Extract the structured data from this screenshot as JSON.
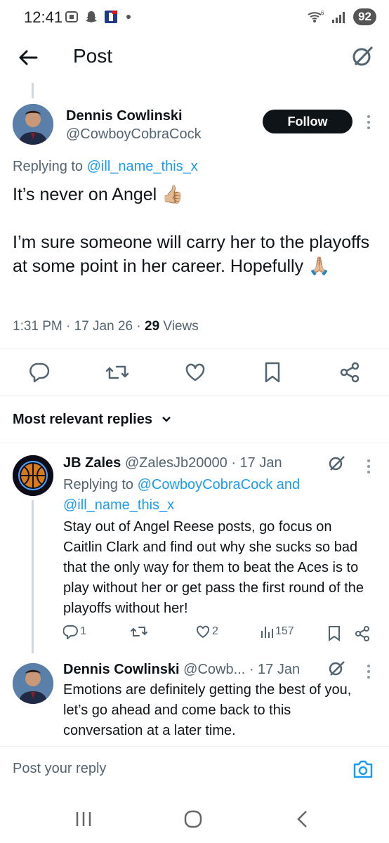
{
  "status_bar": {
    "time": "12:41",
    "battery": "92",
    "signal_label": "6"
  },
  "header": {
    "title": "Post"
  },
  "post": {
    "author_name": "Dennis Cowlinski",
    "author_handle": "@CowboyCobraCock",
    "follow_label": "Follow",
    "replying_prefix": "Replying to ",
    "replying_handle": "@ill_name_this_x",
    "text_line1": "It’s never on Angel 👍🏼",
    "text_line2": "I’m sure someone will carry her to the playoffs at some point in her career. Hopefully 🙏🏼",
    "time": "1:31 PM · 17 Jan 26 · ",
    "views_count": "29",
    "views_label": " Views"
  },
  "replies_section": {
    "title": "Most relevant replies",
    "chevron": "⌄"
  },
  "replies": [
    {
      "name": "JB Zales",
      "handle": "@ZalesJb20000 · 17 Jan",
      "replying_prefix": "Replying to ",
      "replying_handles": "@CowboyCobraCock and @ill_name_this_x",
      "text": "Stay out of Angel Reese posts, go focus on Caitlin Clark and find out why she sucks so bad that the only way for them to beat the Aces is to play without her or get pass the first round of the playoffs without her!",
      "reply_count": "1",
      "retweet_count": "",
      "like_count": "2",
      "view_count": "157"
    },
    {
      "name": "Dennis Cowlinski",
      "handle": "@Cowb... · 17 Jan",
      "text": "Emotions are definitely getting the best of you, let’s go ahead and come back to this conversation at a later time."
    }
  ],
  "reply_bar": {
    "placeholder": "Post your reply"
  },
  "colors": {
    "accent": "#1d9bf0",
    "text": "#0f1419",
    "secondary": "#536471",
    "follow_bg": "#0f1419"
  },
  "icons": [
    "back-arrow-icon",
    "grok-icon",
    "reply-icon",
    "retweet-icon",
    "like-icon",
    "bookmark-icon",
    "share-icon",
    "views-icon",
    "camera-icon",
    "more-icon"
  ]
}
